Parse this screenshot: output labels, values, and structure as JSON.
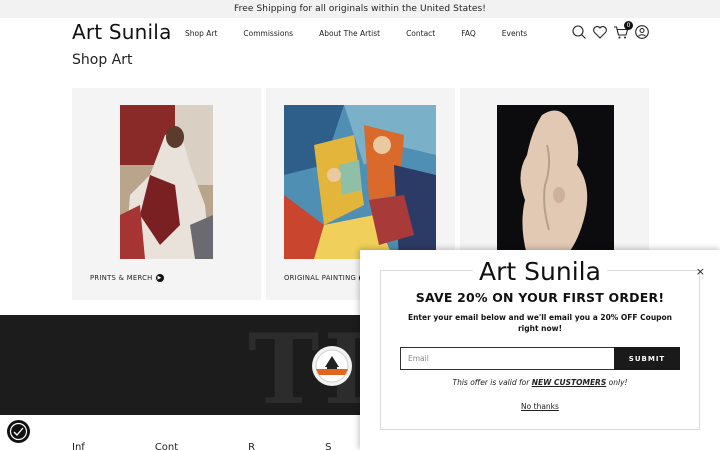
{
  "announcement": "Free Shipping for all originals within the United States!",
  "header": {
    "logo": "Art Sunila",
    "nav": [
      "Shop Art",
      "Commissions",
      "About The Artist",
      "Contact",
      "FAQ",
      "Events"
    ],
    "cart_count": "0"
  },
  "main": {
    "title": "Shop Art",
    "cards": [
      {
        "label": "PRINTS & MERCH",
        "image": "figurative-painting-red"
      },
      {
        "label": "ORIGINAL PAINTING",
        "image": "cubist-painting"
      },
      {
        "label": "",
        "image": "stone-sculpture"
      }
    ]
  },
  "banner": {
    "big_text": "TI",
    "badge": "artist-badge"
  },
  "footer": {
    "columns": [
      "Inf",
      "Cont",
      "R",
      "S"
    ]
  },
  "popup": {
    "brand": "Art Sunila",
    "headline": "SAVE 20% ON YOUR FIRST ORDER!",
    "subtext": "Enter your email below and we'll email you a 20% OFF Coupon right now!",
    "email_placeholder": "Email",
    "submit_label": "SUBMIT",
    "offer_prefix": "This offer is valid for",
    "offer_highlight": "NEW CUSTOMERS",
    "offer_suffix": "only!",
    "decline_label": "No thanks",
    "close_symbol": "×"
  }
}
